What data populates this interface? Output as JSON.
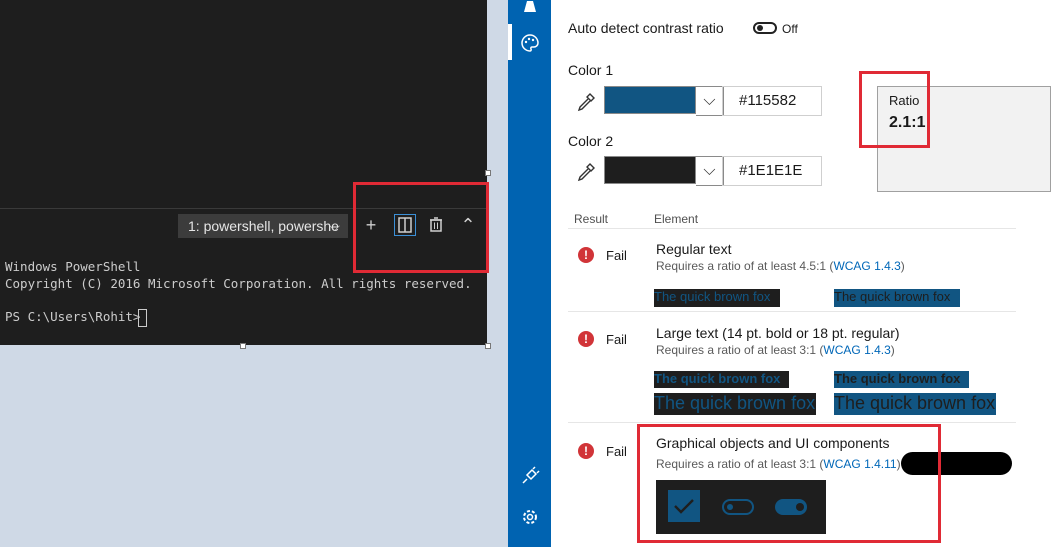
{
  "terminal": {
    "session_label": "1: powershell, powershe",
    "add_icon": "+",
    "split_icon": "split-icon",
    "kill_icon": "trash-icon",
    "maximize_icon": "chevron-up-icon",
    "lines": "Windows PowerShell\nCopyright (C) 2016 Microsoft Corporation. All rights reserved.",
    "prompt": "PS C:\\Users\\Rohit> "
  },
  "contrast": {
    "auto_detect_label": "Auto detect contrast ratio",
    "auto_detect_state": "Off",
    "color1_label": "Color 1",
    "color1_value": "#115582",
    "color2_label": "Color 2",
    "color2_value": "#1E1E1E",
    "ratio_label": "Ratio",
    "ratio_value": "2.1:1",
    "colors": {
      "color1": "#115582",
      "color2": "#1E1E1E"
    }
  },
  "results": {
    "col_result": "Result",
    "col_element": "Element",
    "rows": [
      {
        "status": "Fail",
        "title": "Regular text",
        "req": "Requires a ratio of at least 4.5:1 (",
        "wcag": "WCAG 1.4.3",
        "close": ")"
      },
      {
        "status": "Fail",
        "title": "Large text (14 pt. bold or 18 pt. regular)",
        "req": "Requires a ratio of at least 3:1 (",
        "wcag": "WCAG 1.4.3",
        "close": ")"
      },
      {
        "status": "Fail",
        "title": "Graphical objects and UI components",
        "req": "Requires a ratio of at least 3:1 (",
        "wcag": "WCAG 1.4.11",
        "close": ")"
      }
    ],
    "sample_text": "The quick brown fox"
  }
}
